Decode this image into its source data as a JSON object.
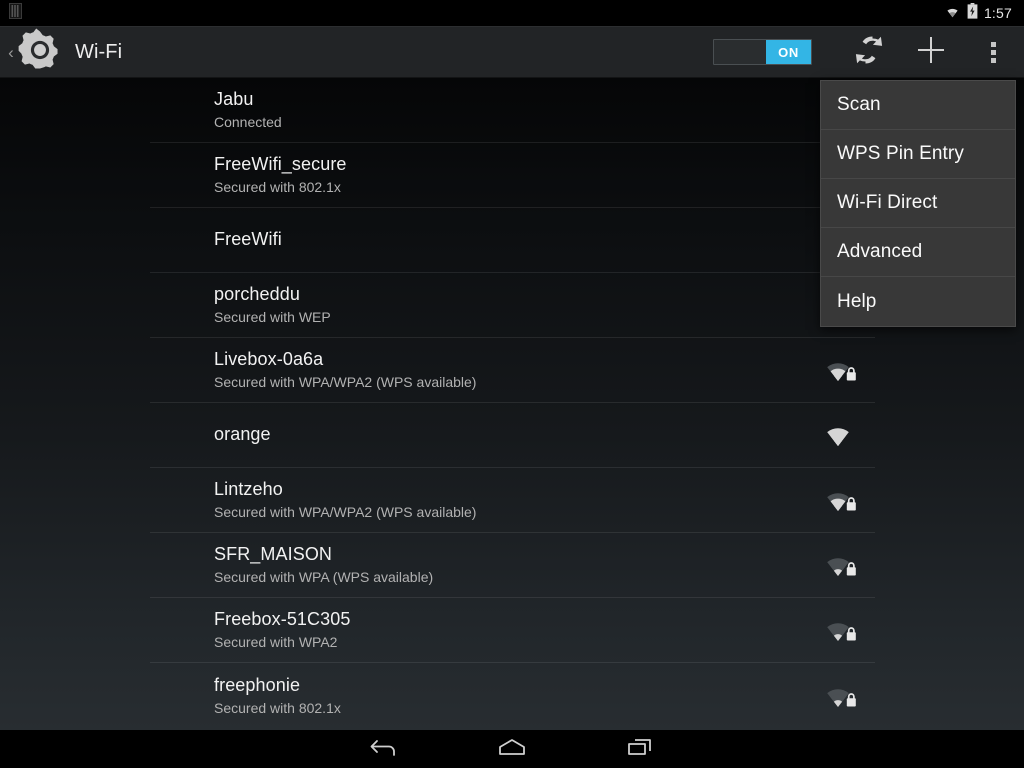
{
  "status_bar": {
    "sim_icon": "sim-card-icon",
    "wifi_icon": "wifi-signal-icon",
    "battery_icon": "battery-charging-icon",
    "clock": "1:57"
  },
  "action_bar": {
    "back_icon": "back-chevron-icon",
    "app_icon": "settings-gear-icon",
    "title": "Wi-Fi",
    "toggle": {
      "label": "ON",
      "state": "on",
      "accent": "#33b5e5"
    },
    "wps_icon": "wps-push-button-icon",
    "add_network_icon": "plus-add-network-icon",
    "overflow_icon": "overflow-menu-icon"
  },
  "overflow_menu": {
    "visible": true,
    "items": [
      {
        "label": "Scan"
      },
      {
        "label": "WPS Pin Entry"
      },
      {
        "label": "Wi-Fi Direct"
      },
      {
        "label": "Advanced"
      },
      {
        "label": "Help"
      }
    ]
  },
  "wifi_list": {
    "networks": [
      {
        "ssid": "Jabu",
        "status": "Connected",
        "secured": false,
        "bars": 0,
        "show_icon": false
      },
      {
        "ssid": "FreeWifi_secure",
        "status": "Secured with 802.1x",
        "secured": true,
        "bars": 0,
        "show_icon": false
      },
      {
        "ssid": "FreeWifi",
        "status": "",
        "secured": false,
        "bars": 0,
        "show_icon": false
      },
      {
        "ssid": "porcheddu",
        "status": "Secured with WEP",
        "secured": true,
        "bars": 0,
        "show_icon": false
      },
      {
        "ssid": "Livebox-0a6a",
        "status": "Secured with WPA/WPA2 (WPS available)",
        "secured": true,
        "bars": 2,
        "show_icon": true
      },
      {
        "ssid": "orange",
        "status": "",
        "secured": false,
        "bars": 3,
        "show_icon": true
      },
      {
        "ssid": "Lintzeho",
        "status": "Secured with WPA/WPA2 (WPS available)",
        "secured": true,
        "bars": 2,
        "show_icon": true
      },
      {
        "ssid": "SFR_MAISON",
        "status": "Secured with WPA (WPS available)",
        "secured": true,
        "bars": 1,
        "show_icon": true
      },
      {
        "ssid": "Freebox-51C305",
        "status": "Secured with WPA2",
        "secured": true,
        "bars": 1,
        "show_icon": true
      },
      {
        "ssid": "freephonie",
        "status": "Secured with 802.1x",
        "secured": true,
        "bars": 1,
        "show_icon": true
      }
    ]
  },
  "nav_bar": {
    "back_icon": "nav-back-icon",
    "home_icon": "nav-home-icon",
    "recents_icon": "nav-recents-icon"
  }
}
